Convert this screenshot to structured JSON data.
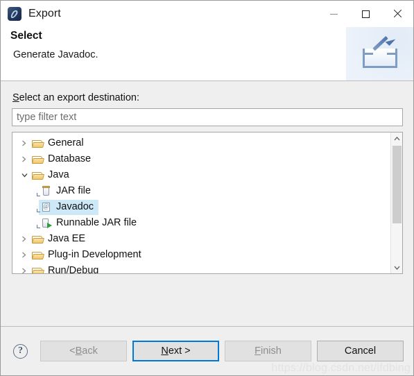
{
  "window": {
    "title": "Export",
    "app_icon": "eclipse-icon",
    "controls": {
      "minimize": "minimize-icon",
      "maximize": "maximize-icon",
      "close": "close-icon"
    }
  },
  "header": {
    "title": "Select",
    "description": "Generate Javadoc.",
    "banner_icon": "export-arrow-icon"
  },
  "form": {
    "label_mnemonic": "S",
    "label_rest": "elect an export destination:",
    "filter_placeholder": "type filter text",
    "filter_value": ""
  },
  "tree": {
    "items": [
      {
        "label": "General",
        "icon": "folder-icon",
        "level": 0,
        "expandable": true,
        "expanded": false,
        "selected": false
      },
      {
        "label": "Database",
        "icon": "folder-icon",
        "level": 0,
        "expandable": true,
        "expanded": false,
        "selected": false
      },
      {
        "label": "Java",
        "icon": "folder-icon",
        "level": 0,
        "expandable": true,
        "expanded": true,
        "selected": false
      },
      {
        "label": "JAR file",
        "icon": "jar-file-icon",
        "level": 1,
        "expandable": false,
        "expanded": false,
        "selected": false
      },
      {
        "label": "Javadoc",
        "icon": "javadoc-icon",
        "level": 1,
        "expandable": false,
        "expanded": false,
        "selected": true
      },
      {
        "label": "Runnable JAR file",
        "icon": "runnable-jar-icon",
        "level": 1,
        "expandable": false,
        "expanded": false,
        "selected": false
      },
      {
        "label": "Java EE",
        "icon": "folder-icon",
        "level": 0,
        "expandable": true,
        "expanded": false,
        "selected": false
      },
      {
        "label": "Plug-in Development",
        "icon": "folder-icon",
        "level": 0,
        "expandable": true,
        "expanded": false,
        "selected": false
      },
      {
        "label": "Run/Debug",
        "icon": "folder-icon",
        "level": 0,
        "expandable": true,
        "expanded": false,
        "selected": false
      }
    ],
    "selection_color": "#cde8f7",
    "scrollbar": {
      "up": "scroll-up-icon",
      "down": "scroll-down-icon"
    }
  },
  "footer": {
    "help": "?",
    "buttons": [
      {
        "id": "back",
        "prefix": "< ",
        "mnemonic": "B",
        "suffix": "ack",
        "state": "disabled"
      },
      {
        "id": "next",
        "prefix": "",
        "mnemonic": "N",
        "suffix": "ext >",
        "state": "default"
      },
      {
        "id": "finish",
        "prefix": "",
        "mnemonic": "F",
        "suffix": "inish",
        "state": "disabled"
      },
      {
        "id": "cancel",
        "prefix": "",
        "mnemonic": "",
        "suffix": "Cancel",
        "state": "enabled"
      }
    ],
    "watermark": "https://blog.csdn.net/ifdbing"
  },
  "colors": {
    "accent": "#0078d7",
    "body_background": "#efefef",
    "selection": "#cde8f7",
    "folder": "#f2c86a"
  }
}
